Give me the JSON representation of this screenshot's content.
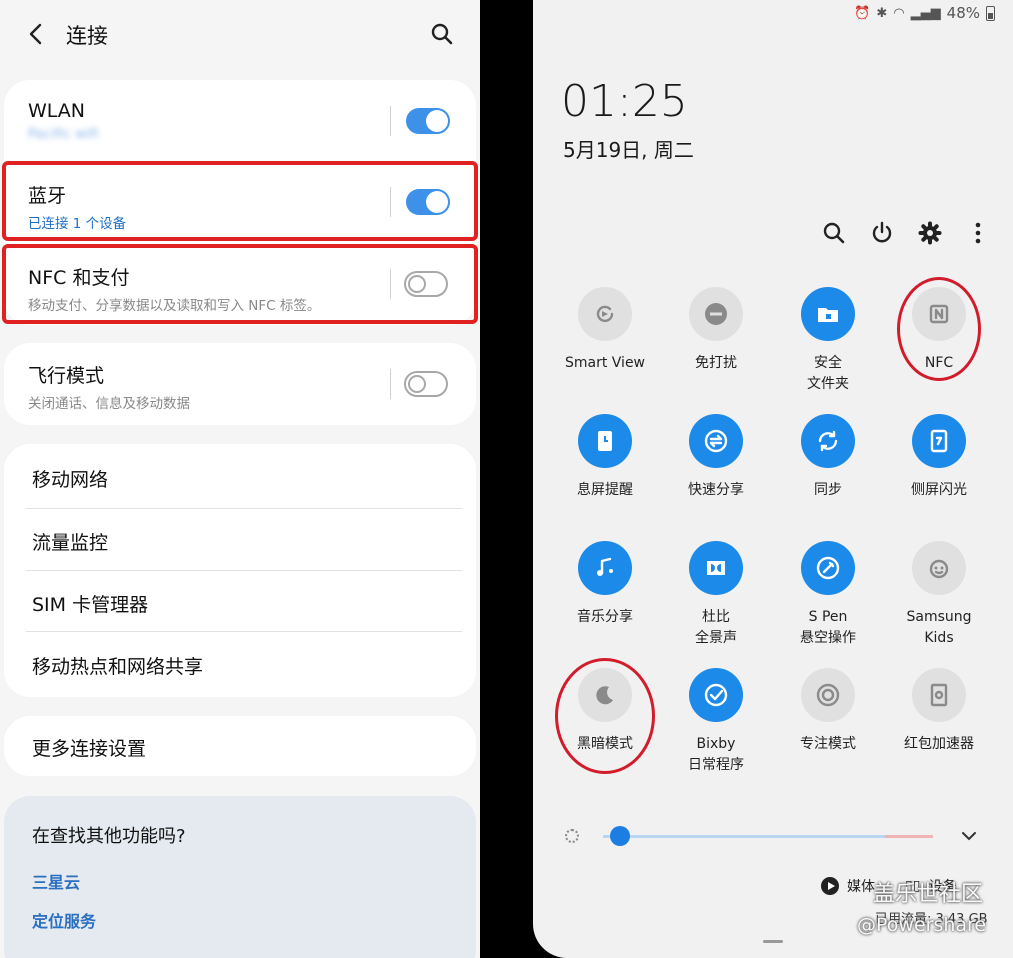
{
  "left": {
    "title": "连接",
    "wlan": {
      "title": "WLAN",
      "subtitle": "Pacific wifi",
      "toggle": true
    },
    "bluetooth": {
      "title": "蓝牙",
      "subtitle": "已连接 1 个设备",
      "toggle": true
    },
    "nfc": {
      "title": "NFC 和支付",
      "subtitle": "移动支付、分享数据以及读取和写入 NFC 标签。",
      "toggle": false
    },
    "airplane": {
      "title": "飞行模式",
      "subtitle": "关闭通话、信息及移动数据",
      "toggle": false
    },
    "list": [
      "移动网络",
      "流量监控",
      "SIM 卡管理器",
      "移动热点和网络共享"
    ],
    "more": "更多连接设置",
    "suggest": {
      "title": "在查找其他功能吗?",
      "links": [
        "三星云",
        "定位服务"
      ]
    }
  },
  "right": {
    "status": {
      "battery": "48%"
    },
    "clock": "01:25",
    "date": "5月19日, 周二",
    "tiles": [
      {
        "label": "Smart View",
        "icon": "smart-view-icon",
        "active": false
      },
      {
        "label": "免打扰",
        "icon": "do-not-disturb-icon",
        "active": false
      },
      {
        "label": "安全\n文件夹",
        "icon": "secure-folder-icon",
        "active": true
      },
      {
        "label": "NFC",
        "icon": "nfc-icon",
        "active": false
      },
      {
        "label": "息屏提醒",
        "icon": "always-on-display-icon",
        "active": true
      },
      {
        "label": "快速分享",
        "icon": "quick-share-icon",
        "active": true
      },
      {
        "label": "同步",
        "icon": "sync-icon",
        "active": true
      },
      {
        "label": "侧屏闪光",
        "icon": "edge-lighting-icon",
        "active": true
      },
      {
        "label": "音乐分享",
        "icon": "music-share-icon",
        "active": true
      },
      {
        "label": "杜比\n全景声",
        "icon": "dolby-atmos-icon",
        "active": true
      },
      {
        "label": "S Pen\n悬空操作",
        "icon": "s-pen-icon",
        "active": true
      },
      {
        "label": "Samsung\nKids",
        "icon": "samsung-kids-icon",
        "active": false
      },
      {
        "label": "黑暗模式",
        "icon": "dark-mode-icon",
        "active": false
      },
      {
        "label": "Bixby\n日常程序",
        "icon": "bixby-routines-icon",
        "active": true
      },
      {
        "label": "专注模式",
        "icon": "focus-mode-icon",
        "active": false
      },
      {
        "label": "红包加速器",
        "icon": "red-envelope-icon",
        "active": false
      }
    ],
    "brightness": 0.05,
    "media_label": "媒体",
    "devices_label": "设备",
    "data_used": "已用流量: 3.43 GB",
    "watermark": {
      "line1": "盖乐世社区",
      "line2": "@Powershare"
    }
  },
  "colors": {
    "accent": "#1c8ae8",
    "highlight": "#e02121"
  }
}
